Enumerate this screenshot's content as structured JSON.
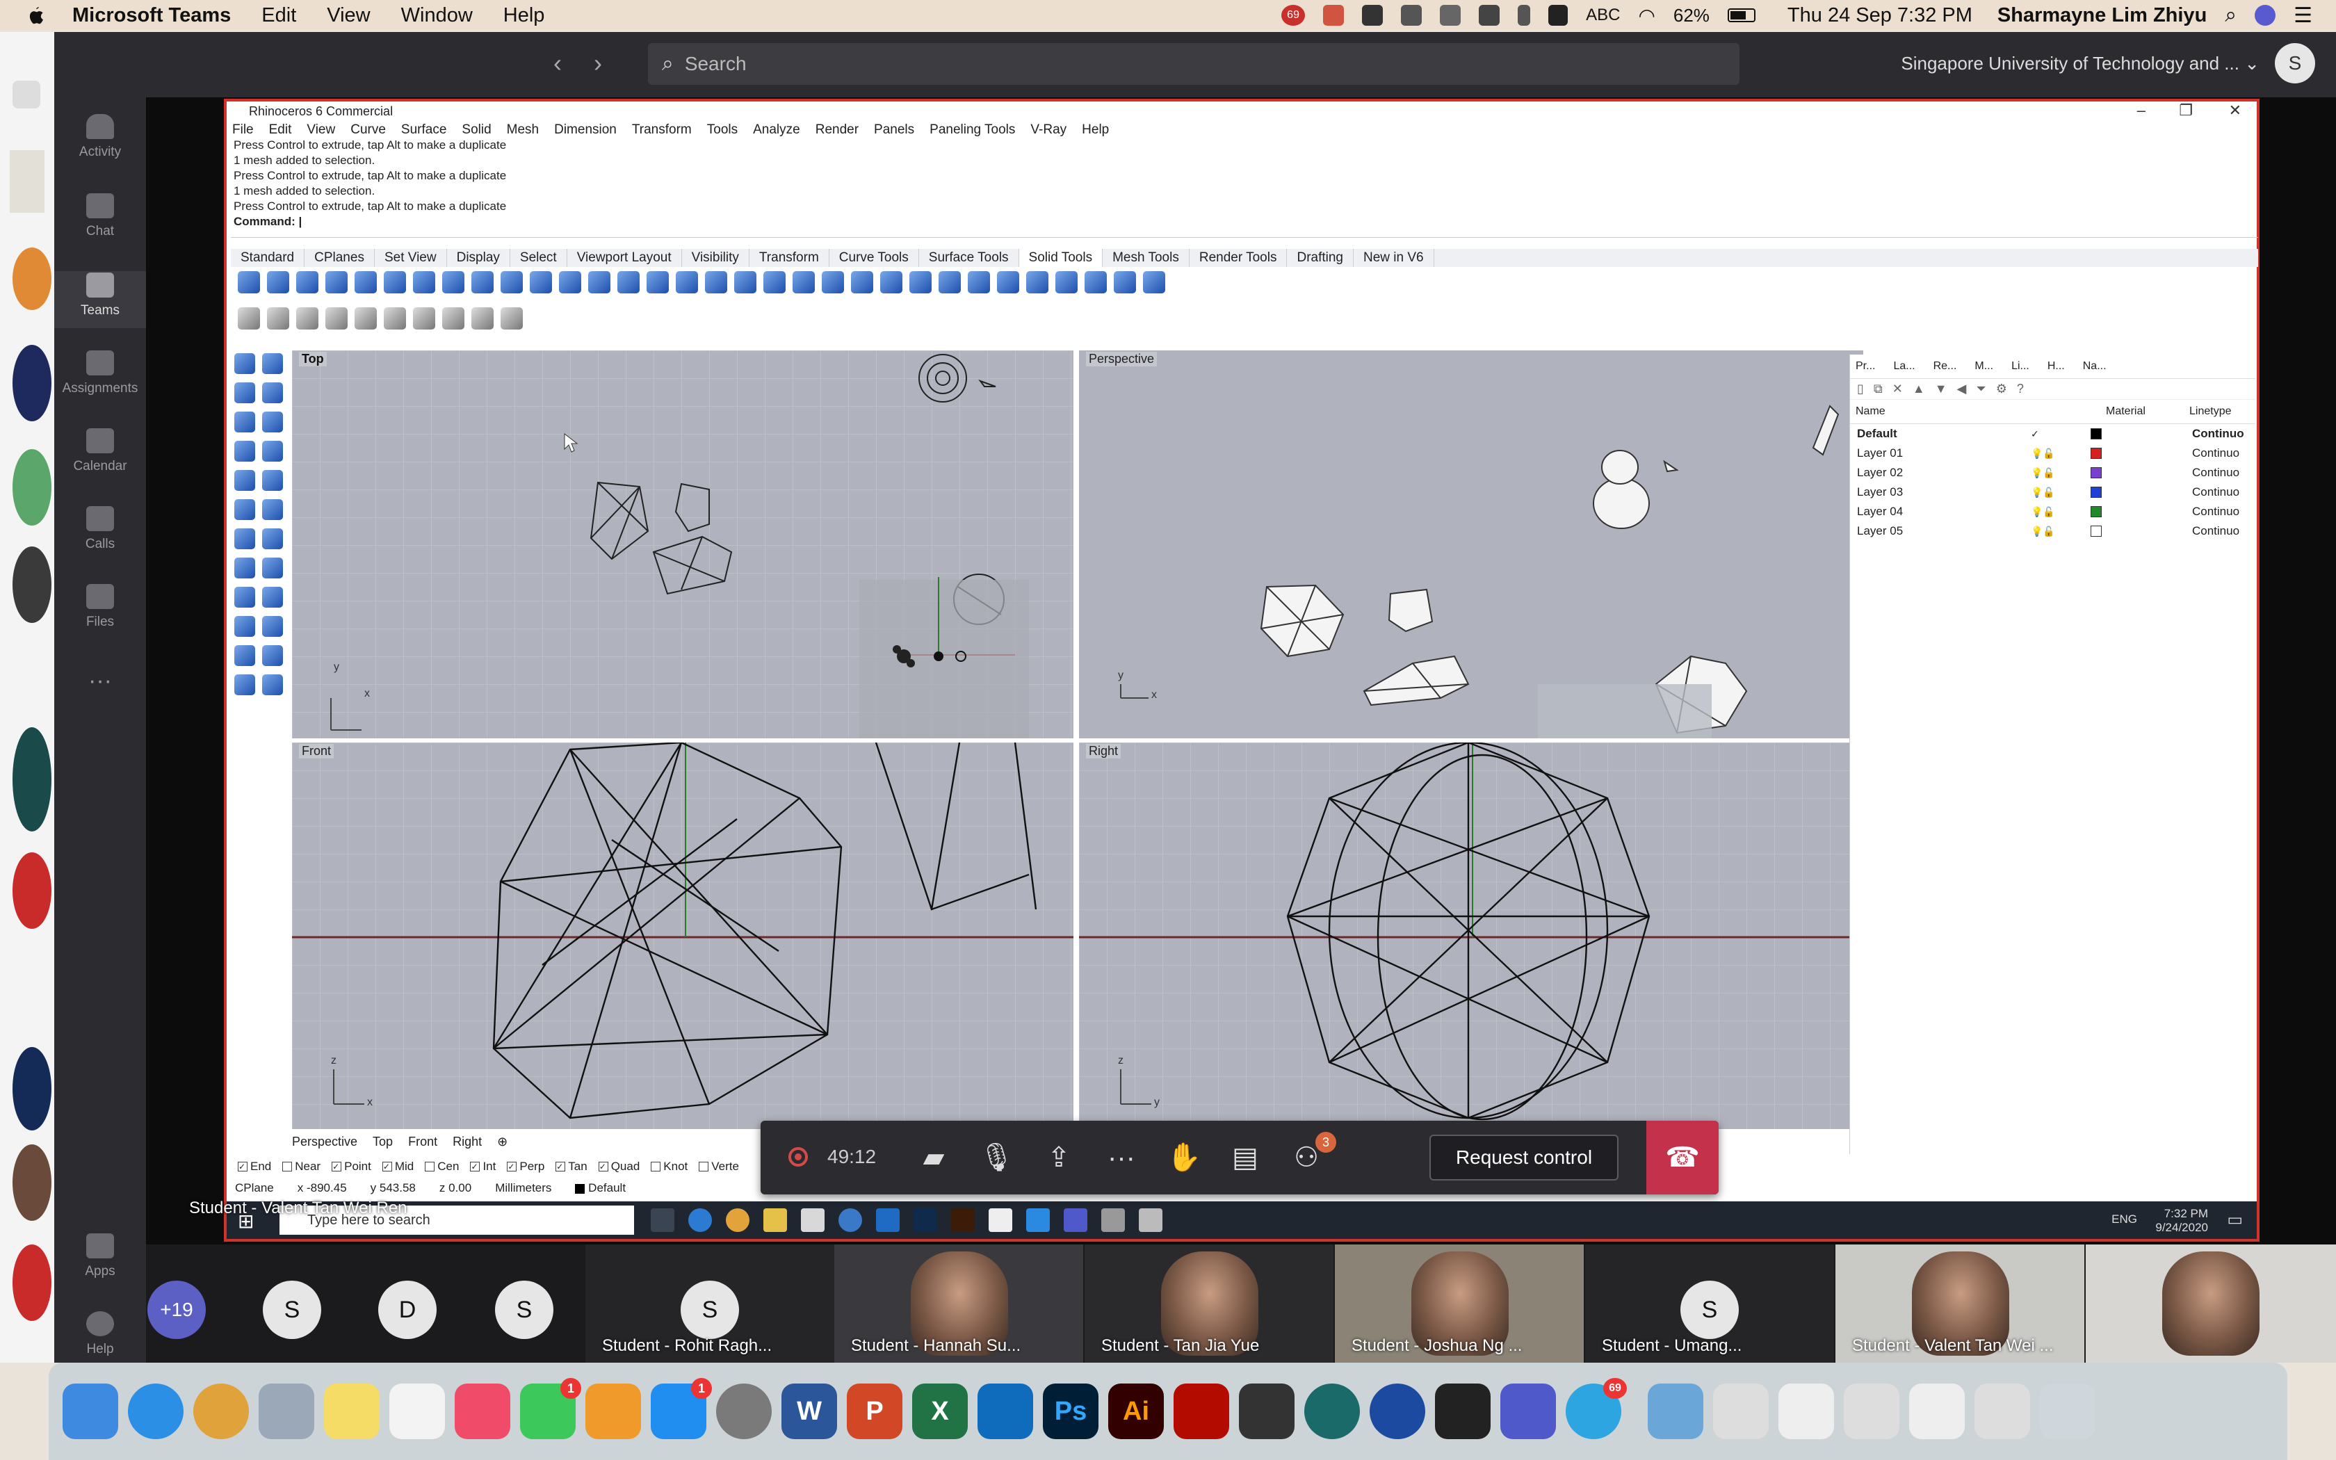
{
  "menubar": {
    "app": "Microsoft Teams",
    "items": [
      "Edit",
      "View",
      "Window",
      "Help"
    ],
    "status_badge": "69",
    "input_source": "ABC",
    "battery": "62%",
    "clock": "Thu 24 Sep  7:32 PM",
    "user": "Sharmayne Lim Zhiyu"
  },
  "teams": {
    "search_placeholder": "Search",
    "org": "Singapore University of Technology and ...",
    "me_initial": "S",
    "rail": [
      {
        "label": "Activity",
        "active": false
      },
      {
        "label": "Chat",
        "active": false
      },
      {
        "label": "Teams",
        "active": true
      },
      {
        "label": "Assignments",
        "active": false
      },
      {
        "label": "Calendar",
        "active": false
      },
      {
        "label": "Calls",
        "active": false
      },
      {
        "label": "Files",
        "active": false
      },
      {
        "label": "Apps",
        "active": false
      },
      {
        "label": "Help",
        "active": false
      }
    ]
  },
  "rhino": {
    "title": "Rhinoceros 6 Commercial",
    "menu": [
      "File",
      "Edit",
      "View",
      "Curve",
      "Surface",
      "Solid",
      "Mesh",
      "Dimension",
      "Transform",
      "Tools",
      "Analyze",
      "Render",
      "Panels",
      "Paneling Tools",
      "V-Ray",
      "Help"
    ],
    "history": [
      "Press Control to extrude, tap Alt to make a duplicate",
      "1 mesh added to selection.",
      "Press Control to extrude, tap Alt to make a duplicate",
      "1 mesh added to selection.",
      "Press Control to extrude, tap Alt to make a duplicate"
    ],
    "command_label": "Command:",
    "toolbar_tabs": [
      "Standard",
      "CPlanes",
      "Set View",
      "Display",
      "Select",
      "Viewport Layout",
      "Visibility",
      "Transform",
      "Curve Tools",
      "Surface Tools",
      "Solid Tools",
      "Mesh Tools",
      "Render Tools",
      "Drafting",
      "New in V6"
    ],
    "active_tab": "Solid Tools",
    "viewports": {
      "top": "Top",
      "perspective": "Perspective",
      "front": "Front",
      "right": "Right"
    },
    "viewport_tabs": [
      "Perspective",
      "Top",
      "Front",
      "Right"
    ],
    "osnaps": [
      {
        "label": "End",
        "checked": true
      },
      {
        "label": "Near",
        "checked": false
      },
      {
        "label": "Point",
        "checked": true
      },
      {
        "label": "Mid",
        "checked": true
      },
      {
        "label": "Cen",
        "checked": false
      },
      {
        "label": "Int",
        "checked": true
      },
      {
        "label": "Perp",
        "checked": true
      },
      {
        "label": "Tan",
        "checked": true
      },
      {
        "label": "Quad",
        "checked": true
      },
      {
        "label": "Knot",
        "checked": false
      },
      {
        "label": "Verte",
        "checked": false
      }
    ],
    "status": {
      "cplane": "CPlane",
      "x": "x -890.45",
      "y": "y 543.58",
      "z": "z 0.00",
      "units": "Millimeters",
      "layer": "Default"
    },
    "layers_panel": {
      "tabs": [
        "Pr...",
        "La...",
        "Re...",
        "M...",
        "Li...",
        "H...",
        "Na..."
      ],
      "headers": {
        "name": "Name",
        "material": "Material",
        "linetype": "Linetype"
      },
      "rows": [
        {
          "name": "Default",
          "current": true,
          "color": "#000000",
          "linetype": "Continuo"
        },
        {
          "name": "Layer 01",
          "current": false,
          "color": "#d62020",
          "linetype": "Continuo"
        },
        {
          "name": "Layer 02",
          "current": false,
          "color": "#7a3fd0",
          "linetype": "Continuo"
        },
        {
          "name": "Layer 03",
          "current": false,
          "color": "#1f3fd6",
          "linetype": "Continuo"
        },
        {
          "name": "Layer 04",
          "current": false,
          "color": "#1f8a2a",
          "linetype": "Continuo"
        },
        {
          "name": "Layer 05",
          "current": false,
          "color": "#ffffff",
          "linetype": "Continuo"
        }
      ]
    },
    "taskbar": {
      "search": "Type here to search",
      "time": "7:32 PM",
      "date": "9/24/2020",
      "lang": "ENG"
    }
  },
  "call": {
    "timer": "49:12",
    "request_control": "Request control",
    "participants_badge": "3",
    "presenter_overlay": "Student - Valent Tan Wei Ren"
  },
  "participants": {
    "overflow": "+19",
    "circles": [
      "S",
      "D",
      "S"
    ],
    "tiles": [
      {
        "name": "Student - Rohit Ragh...",
        "video": false,
        "initial": "S"
      },
      {
        "name": "Student - Hannah Su...",
        "video": true
      },
      {
        "name": "Student - Tan Jia Yue",
        "video": true
      },
      {
        "name": "Student - Joshua Ng ...",
        "video": true
      },
      {
        "name": "Student - Umang...",
        "video": false,
        "initial": "S"
      },
      {
        "name": "Student - Valent Tan Wei ...",
        "video": true
      },
      {
        "name": "",
        "video": true
      }
    ]
  },
  "dock": {
    "badges": {
      "messages": "1",
      "appstore": "1",
      "telegram": "69"
    },
    "labels": [
      "W",
      "P",
      "X",
      "Ps",
      "Ai"
    ]
  }
}
